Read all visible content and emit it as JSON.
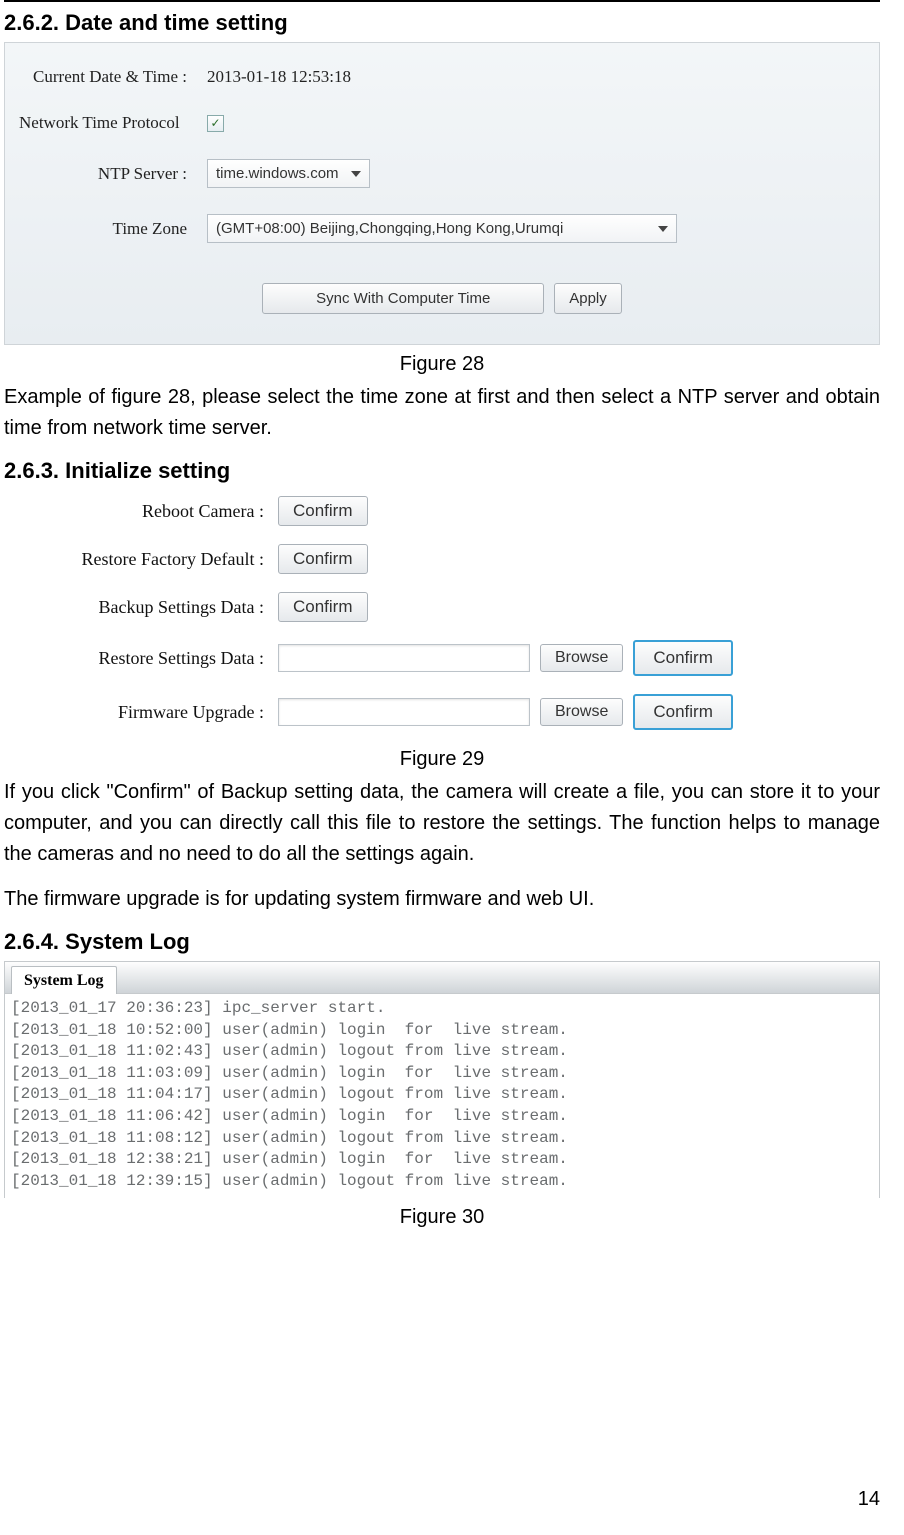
{
  "page_number": "14",
  "sections": {
    "s262": {
      "heading": "2.6.2. Date and time setting",
      "caption": "Figure 28",
      "body": "Example of figure 28, please select the time zone at first and then select a NTP server and obtain time from network time server."
    },
    "s263": {
      "heading": "2.6.3. Initialize setting",
      "caption": "Figure 29",
      "body1": "If you click \"Confirm\" of Backup setting data, the camera will create a file, you can store it to your computer, and you can directly call this file to restore the settings. The function helps to manage the cameras and no need to do all the settings again.",
      "body2": "The firmware upgrade is for updating system firmware and web UI."
    },
    "s264": {
      "heading": "2.6.4. System Log",
      "caption": "Figure 30"
    }
  },
  "datetime_panel": {
    "current_label": "Current Date & Time :",
    "current_value": "2013-01-18 12:53:18",
    "ntp_label": "Network Time Protocol",
    "ntp_checked_glyph": "✓",
    "ntp_server_label": "NTP Server :",
    "ntp_server_value": "time.windows.com",
    "tz_label": "Time Zone",
    "tz_value": "(GMT+08:00) Beijing,Chongqing,Hong Kong,Urumqi",
    "sync_button": "Sync With Computer Time",
    "apply_button": "Apply"
  },
  "init_panel": {
    "reboot_label": "Reboot Camera :",
    "restore_factory_label": "Restore Factory Default :",
    "backup_label": "Backup Settings Data :",
    "restore_data_label": "Restore Settings Data :",
    "firmware_label": "Firmware Upgrade :",
    "confirm": "Confirm",
    "browse": "Browse"
  },
  "syslog": {
    "tab_label": "System Log",
    "lines": [
      "[2013_01_17 20:36:23] ipc_server start.",
      "[2013_01_18 10:52:00] user(admin) login  for  live stream.",
      "[2013_01_18 11:02:43] user(admin) logout from live stream.",
      "[2013_01_18 11:03:09] user(admin) login  for  live stream.",
      "[2013_01_18 11:04:17] user(admin) logout from live stream.",
      "[2013_01_18 11:06:42] user(admin) login  for  live stream.",
      "[2013_01_18 11:08:12] user(admin) logout from live stream.",
      "[2013_01_18 12:38:21] user(admin) login  for  live stream.",
      "[2013_01_18 12:39:15] user(admin) logout from live stream."
    ]
  }
}
